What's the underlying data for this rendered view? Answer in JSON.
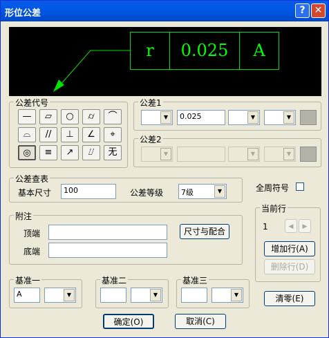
{
  "window": {
    "title": "形位公差",
    "help": "?",
    "close": "✕"
  },
  "preview": {
    "symbol": "r",
    "value": "0.025",
    "datum": "A"
  },
  "symbols_group": {
    "label": "公差代号",
    "symbols": [
      "—",
      "▱",
      "○",
      "⌭",
      "⌒",
      "⌓",
      "//",
      "⊥",
      "∠",
      "⌖",
      "◎",
      "≡",
      "↗",
      "⌰",
      "无"
    ]
  },
  "tol1": {
    "label": "公差1",
    "value": "0.025"
  },
  "tol2": {
    "label": "公差2"
  },
  "lookup": {
    "label": "公差查表",
    "size_label": "基本尺寸",
    "size_value": "100",
    "grade_label": "公差等级",
    "grade_value": "7级"
  },
  "all_around": {
    "label": "全周符号"
  },
  "notes": {
    "label": "附注",
    "top_label": "顶端",
    "bottom_label": "底端",
    "fit_button": "尺寸与配合"
  },
  "current_row": {
    "label": "当前行",
    "value": "1",
    "add": "增加行(A)",
    "delete": "删除行(D)"
  },
  "datums": {
    "d1_label": "基准一",
    "d1_value": "A",
    "d2_label": "基准二",
    "d3_label": "基准三"
  },
  "buttons": {
    "clear": "清零(E)",
    "ok": "确定(O)",
    "cancel": "取消(C)"
  }
}
